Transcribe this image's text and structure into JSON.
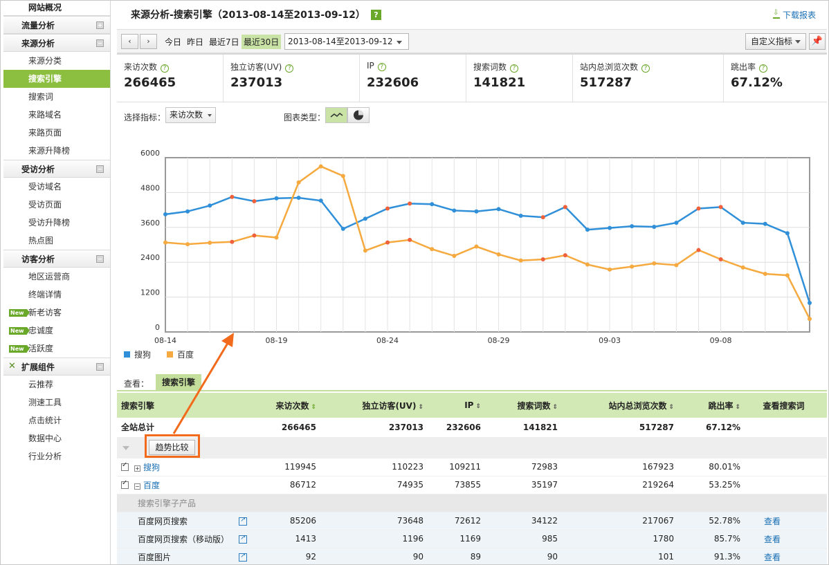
{
  "sidebar": {
    "top_item": "网站概况",
    "groups": [
      {
        "title": "流量分析",
        "toggle": "plus",
        "items": []
      },
      {
        "title": "来源分析",
        "toggle": "minus",
        "items": [
          {
            "label": "来源分类",
            "active": false,
            "new": false
          },
          {
            "label": "搜索引擎",
            "active": true,
            "new": false
          },
          {
            "label": "搜索词",
            "active": false,
            "new": false
          },
          {
            "label": "来路域名",
            "active": false,
            "new": false
          },
          {
            "label": "来路页面",
            "active": false,
            "new": false
          },
          {
            "label": "来源升降榜",
            "active": false,
            "new": false
          }
        ]
      },
      {
        "title": "受访分析",
        "toggle": "minus",
        "items": [
          {
            "label": "受访域名",
            "active": false,
            "new": false
          },
          {
            "label": "受访页面",
            "active": false,
            "new": false
          },
          {
            "label": "受访升降榜",
            "active": false,
            "new": false
          },
          {
            "label": "热点图",
            "active": false,
            "new": false
          }
        ]
      },
      {
        "title": "访客分析",
        "toggle": "minus",
        "items": [
          {
            "label": "地区运营商",
            "active": false,
            "new": false
          },
          {
            "label": "终端详情",
            "active": false,
            "new": false
          },
          {
            "label": "新老访客",
            "active": false,
            "new": true
          },
          {
            "label": "忠诚度",
            "active": false,
            "new": true
          },
          {
            "label": "活跃度",
            "active": false,
            "new": true
          }
        ]
      },
      {
        "title": "扩展组件",
        "toggle": "minus",
        "icon": "wrench-icon",
        "items": [
          {
            "label": "云推荐",
            "active": false,
            "new": false
          },
          {
            "label": "测速工具",
            "active": false,
            "new": false
          },
          {
            "label": "点击统计",
            "active": false,
            "new": false
          },
          {
            "label": "数据中心",
            "active": false,
            "new": false
          },
          {
            "label": "行业分析",
            "active": false,
            "new": false
          }
        ]
      }
    ],
    "new_badge_text": "New"
  },
  "header": {
    "title": "来源分析-搜索引擎（2013-08-14至2013-09-12）",
    "help_label": "?",
    "download_label": "下载报表"
  },
  "toolbar": {
    "prev_label": "‹",
    "next_label": "›",
    "ranges": [
      {
        "label": "今日",
        "active": false
      },
      {
        "label": "昨日",
        "active": false
      },
      {
        "label": "最近7日",
        "active": false
      },
      {
        "label": "最近30日",
        "active": true
      }
    ],
    "date_range_value": "2013-08-14至2013-09-12",
    "custom_metric_label": "自定义指标",
    "pin_icon": "pin-icon"
  },
  "stats": [
    {
      "label": "来访次数",
      "value": "266465"
    },
    {
      "label": "独立访客(UV)",
      "value": "237013"
    },
    {
      "label": "IP",
      "value": "232606"
    },
    {
      "label": "搜索词数",
      "value": "141821"
    },
    {
      "label": "站内总浏览次数",
      "value": "517287"
    },
    {
      "label": "跳出率",
      "value": "67.12%"
    }
  ],
  "chart_controls": {
    "select_metric_label": "选择指标：",
    "selected_metric": "来访次数",
    "chart_type_label": "图表类型：",
    "chart_types": [
      "line-chart-icon",
      "pie-chart-icon"
    ]
  },
  "chart_data": {
    "type": "line",
    "x": [
      "08-14",
      "08-15",
      "08-16",
      "08-17",
      "08-18",
      "08-19",
      "08-20",
      "08-21",
      "08-22",
      "08-23",
      "08-24",
      "08-25",
      "08-26",
      "08-27",
      "08-28",
      "08-29",
      "08-30",
      "08-31",
      "09-01",
      "09-02",
      "09-03",
      "09-04",
      "09-05",
      "09-06",
      "09-07",
      "09-08",
      "09-09",
      "09-10",
      "09-11",
      "09-12"
    ],
    "x_tick_labels": [
      "08-14",
      "08-19",
      "08-24",
      "08-29",
      "09-03",
      "09-08"
    ],
    "ylim": [
      0,
      6000
    ],
    "y_ticks": [
      "0",
      "1200",
      "2400",
      "3600",
      "4800",
      "6000"
    ],
    "grid": true,
    "legend_position": "bottom-left",
    "series": [
      {
        "name": "搜狗",
        "color": "#2f8fd8",
        "values": [
          4050,
          4150,
          4350,
          4650,
          4500,
          4600,
          4620,
          4520,
          3550,
          3900,
          4250,
          4420,
          4400,
          4180,
          4150,
          4230,
          4000,
          3950,
          4300,
          3520,
          3580,
          3640,
          3620,
          3760,
          4250,
          4300,
          3760,
          3720,
          3400,
          1000
        ],
        "highlight_points": [
          3,
          4,
          10,
          11,
          17,
          18,
          24,
          25
        ]
      },
      {
        "name": "百度",
        "color": "#f5a93e",
        "values": [
          3080,
          3020,
          3070,
          3100,
          3320,
          3250,
          5150,
          5700,
          5370,
          2800,
          3080,
          3170,
          2850,
          2620,
          2940,
          2670,
          2460,
          2500,
          2640,
          2320,
          2150,
          2250,
          2360,
          2300,
          2820,
          2500,
          2220,
          2000,
          1950,
          450
        ],
        "highlight_points": [
          3,
          4,
          10,
          11,
          17,
          18,
          24,
          25
        ]
      }
    ]
  },
  "view_tabs": {
    "label": "查看：",
    "active_tab": "搜索引擎"
  },
  "table": {
    "headers": [
      "搜索引擎",
      "来访次数",
      "独立访客(UV)",
      "IP",
      "搜索词数",
      "站内总浏览次数",
      "跳出率",
      "查看搜索词"
    ],
    "total": {
      "name": "全站总计",
      "visits": "266465",
      "uv": "237013",
      "ip": "232606",
      "keywords": "141821",
      "pageviews": "517287",
      "bounce": "67.12%"
    },
    "compare_button_label": "趋势比较",
    "rows": [
      {
        "name": "搜狗",
        "checked": true,
        "expand": "+",
        "visits": "119945",
        "uv": "110223",
        "ip": "109211",
        "keywords": "72983",
        "pageviews": "167923",
        "bounce": "80.01%"
      },
      {
        "name": "百度",
        "checked": true,
        "expand": "−",
        "visits": "86712",
        "uv": "74935",
        "ip": "73855",
        "keywords": "35197",
        "pageviews": "219264",
        "bounce": "53.25%"
      }
    ],
    "sub_header": "搜索引擎子产品",
    "sub_rows": [
      {
        "name": "百度网页搜索",
        "visits": "85206",
        "uv": "73648",
        "ip": "72612",
        "keywords": "34122",
        "pageviews": "217067",
        "bounce": "52.78%",
        "view": "查看"
      },
      {
        "name": "百度网页搜索（移动版）",
        "visits": "1413",
        "uv": "1196",
        "ip": "1169",
        "keywords": "985",
        "pageviews": "1780",
        "bounce": "85.7%",
        "view": "查看"
      },
      {
        "name": "百度图片",
        "visits": "92",
        "uv": "90",
        "ip": "89",
        "keywords": "90",
        "pageviews": "101",
        "bounce": "91.3%",
        "view": "查看"
      }
    ]
  },
  "colors": {
    "accent_green": "#8cbf3f",
    "header_green": "#d3e9b5",
    "annotation_orange": "#f26a1b",
    "link_blue": "#1a6fb5"
  }
}
